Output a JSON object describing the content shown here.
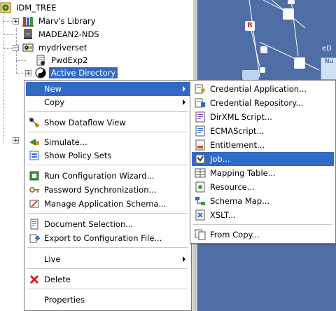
{
  "tree": {
    "root": {
      "label": "IDM_TREE"
    },
    "items": [
      {
        "label": "Marv's Library"
      },
      {
        "label": "MADEAN2-NDS"
      },
      {
        "label": "mydriverset"
      },
      {
        "label": "PwdExp2"
      },
      {
        "label": "Active Directory"
      }
    ]
  },
  "canvas": {
    "label_r": "R",
    "label_e": "eD",
    "label_n": "Nu"
  },
  "context_menu": {
    "new": "New",
    "copy": "Copy",
    "show_dataflow": "Show Dataflow View",
    "simulate": "Simulate...",
    "show_policy_sets": "Show Policy Sets",
    "run_config_wizard": "Run Configuration Wizard...",
    "password_sync": "Password Synchronization...",
    "manage_app_schema": "Manage Application Schema...",
    "document_selection": "Document Selection...",
    "export_config": "Export to Configuration File...",
    "live": "Live",
    "delete": "Delete",
    "properties": "Properties"
  },
  "submenu": {
    "credential_application": "Credential Application...",
    "credential_repository": "Credential Repository...",
    "dirxml_script": "DirXML Script...",
    "ecmascript": "ECMAScript...",
    "entitlement": "Entitlement...",
    "job": "Job...",
    "mapping_table": "Mapping Table...",
    "resource": "Resource...",
    "schema_map": "Schema Map...",
    "xslt": "XSLT...",
    "from_copy": "From Copy..."
  },
  "colors": {
    "selection": "#316ac5",
    "canvas": "#4f6ea6"
  }
}
